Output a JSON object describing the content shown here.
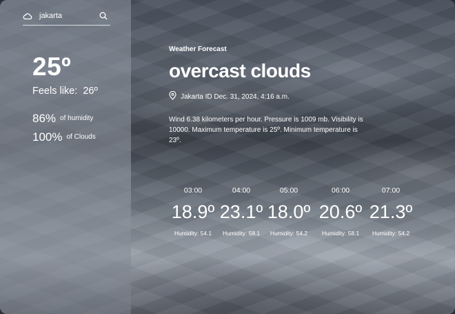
{
  "search": {
    "value": "jakarta",
    "icons": {
      "left": "cloud-icon",
      "right": "search-icon"
    }
  },
  "current": {
    "temp": "25º",
    "feels_like_label": "Feels like:",
    "feels_like_value": "26º",
    "humidity_value": "86%",
    "humidity_label": "of humidity",
    "clouds_value": "100%",
    "clouds_label": "of Clouds"
  },
  "forecast": {
    "kicker": "Weather Forecast",
    "headline": "overcast clouds",
    "location": "Jakarta ID Dec. 31, 2024, 4:16 a.m.",
    "location_icon": "location-pin-icon",
    "description": "Wind 6.38 kilometers per hour. Pressure is 1009 mb. Visibility is 10000. Maximum temperature is 25º. Minimum temperature is 23º."
  },
  "hourly": [
    {
      "time": "03:00",
      "temp": "18.9º",
      "humidity": "Humidity: 54.1"
    },
    {
      "time": "04:00",
      "temp": "23.1º",
      "humidity": "Humidity: 58.1"
    },
    {
      "time": "05:00",
      "temp": "18.0º",
      "humidity": "Humidity: 54.2"
    },
    {
      "time": "06:00",
      "temp": "20.6º",
      "humidity": "Humidity: 58.1"
    },
    {
      "time": "07:00",
      "temp": "21.3º",
      "humidity": "Humidity: 54.2"
    }
  ],
  "colors": {
    "text": "#ffffff",
    "panel_overlay": "#9aa0aa"
  }
}
